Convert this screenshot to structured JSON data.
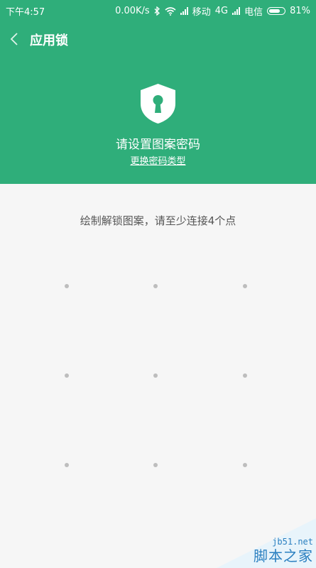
{
  "status_bar": {
    "time": "下午4:57",
    "network_speed": "0.00K/s",
    "carrier1": "移动",
    "network_type": "4G",
    "carrier2": "电信",
    "battery": "81%",
    "battery_level": 0.81,
    "icons": [
      "bluetooth-icon",
      "wifi-icon",
      "signal-icon",
      "signal-icon",
      "battery-icon"
    ]
  },
  "header": {
    "title": "应用锁",
    "back_icon": "chevron-left-icon",
    "shield_icon": "shield-keyhole-icon",
    "pattern_title": "请设置图案密码",
    "change_type": "更换密码类型"
  },
  "body": {
    "instruction": "绘制解锁图案，请至少连接4个点"
  },
  "colors": {
    "header_bg": "#2fae7a",
    "page_bg": "#f6f6f6",
    "dot": "#bdbdbd",
    "watermark": "#2a7fc0"
  },
  "watermark": {
    "site": "jb51.net",
    "name": "脚本之家"
  }
}
